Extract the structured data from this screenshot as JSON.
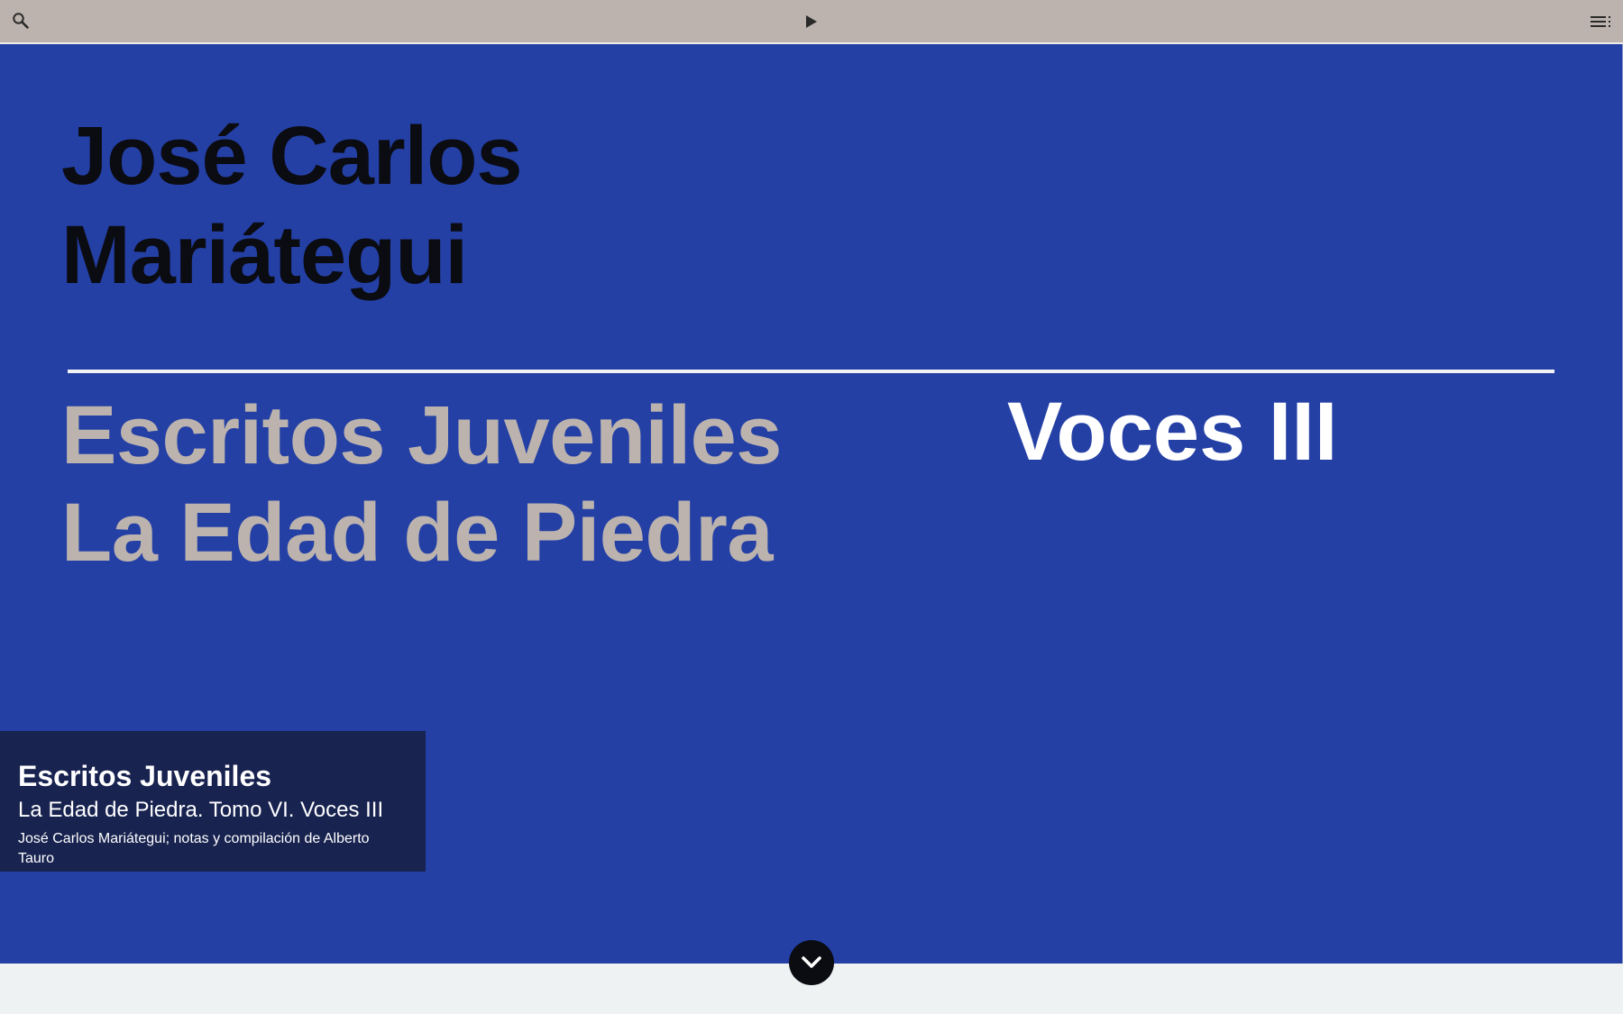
{
  "toolbar": {
    "search_icon": "search-icon",
    "play_icon": "play-icon",
    "menu_icon": "list-menu-icon"
  },
  "cover": {
    "author": "José Carlos\nMariátegui",
    "title": "Escritos Juveniles\nLa Edad de Piedra",
    "volume": "Voces III",
    "colors": {
      "background": "#2440a5",
      "author": "#0b0b12",
      "title": "#bcb3ae",
      "volume": "#ffffff"
    }
  },
  "info": {
    "title": "Escritos Juveniles",
    "subtitle": "La Edad de Piedra. Tomo VI. Voces III",
    "credit": "José Carlos Mariátegui; notas y compilación de Alberto Tauro"
  },
  "scroll": {
    "icon": "chevron-down-icon"
  }
}
